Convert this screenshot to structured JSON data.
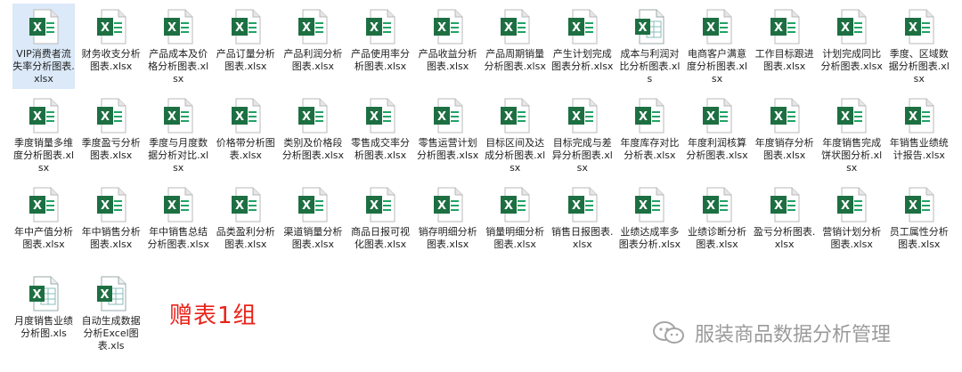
{
  "files": [
    {
      "label": "VIP消费者流失率分析图表.xlsx",
      "selected": true
    },
    {
      "label": "财务收支分析图表.xlsx"
    },
    {
      "label": "产品成本及价格分析图表.xlsx"
    },
    {
      "label": "产品订量分析图表.xlsx"
    },
    {
      "label": "产品利润分析图表.xlsx"
    },
    {
      "label": "产品使用率分析图表.xlsx"
    },
    {
      "label": "产品收益分析图表.xlsx"
    },
    {
      "label": "产品周期销量分析图表.xlsx"
    },
    {
      "label": "产生计划完成图表分析.xlsx"
    },
    {
      "label": "成本与利润对比分析图表.xls",
      "old": true
    },
    {
      "label": "电商客户满意度分析图表.xlsx"
    },
    {
      "label": "工作目标跟进图表.xlsx"
    },
    {
      "label": "计划完成同比分析图表.xlsx"
    },
    {
      "label": "季度、区域数据分析图表.xlsx"
    },
    {
      "label": "季度销量多维度分析图表.xlsx"
    },
    {
      "label": "季度盈亏分析图表.xlsx"
    },
    {
      "label": "季度与月度数据分析对比.xlsx"
    },
    {
      "label": "价格带分析图表.xlsx"
    },
    {
      "label": "类别及价格段分析图表.xlsx"
    },
    {
      "label": "零售成交率分析图表.xlsx"
    },
    {
      "label": "零售运营计划分析图表.xlsx"
    },
    {
      "label": "目标区间及达成分析图表.xlsx"
    },
    {
      "label": "目标完成与差异分析图表.xlsx"
    },
    {
      "label": "年度库存对比分析表.xlsx"
    },
    {
      "label": "年度利润核算分析图表.xlsx"
    },
    {
      "label": "年度销存分析图表.xlsx"
    },
    {
      "label": "年度销售完成饼状图分析.xlsx"
    },
    {
      "label": "年销售业绩统计报告.xlsx"
    },
    {
      "label": "年中产值分析图表.xlsx"
    },
    {
      "label": "年中销售分析图表.xlsx"
    },
    {
      "label": "年中销售总结分析图表.xlsx"
    },
    {
      "label": "品类盈利分析图表.xlsx"
    },
    {
      "label": "渠道销量分析图表.xlsx"
    },
    {
      "label": "商品日报可视化图表.xlsx"
    },
    {
      "label": "销存明细分析图表.xlsx"
    },
    {
      "label": "销量明细分析图表.xlsx"
    },
    {
      "label": "销售日报图表.xlsx"
    },
    {
      "label": "业绩达成率多图表分析.xlsx"
    },
    {
      "label": "业绩诊断分析图表.xlsx"
    },
    {
      "label": "盈亏分析图表.xlsx"
    },
    {
      "label": "营销计划分析图表.xlsx"
    },
    {
      "label": "员工属性分析图表.xlsx"
    },
    {
      "label": "月度销售业绩分析图.xls",
      "old": true
    },
    {
      "label": "自动生成数据分析Excel图表.xls",
      "old": true
    }
  ],
  "gift_label": "赠表1组",
  "watermark_text": "服装商品数据分析管理",
  "colors": {
    "excel_green": "#1d6f42",
    "excel_light": "#21a366",
    "selection": "#dbe9f8",
    "gift_red": "#e8231a"
  }
}
